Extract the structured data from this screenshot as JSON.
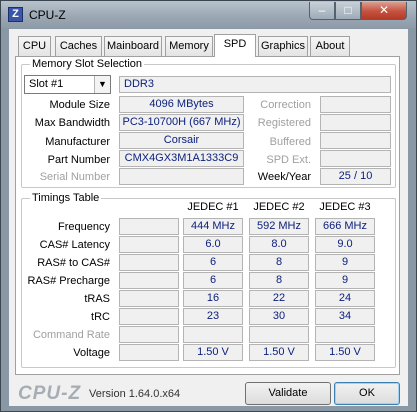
{
  "window": {
    "title": "CPU-Z",
    "app_icon": "Z",
    "min": "–",
    "max": "□",
    "close": "✕"
  },
  "tabs": [
    "CPU",
    "Caches",
    "Mainboard",
    "Memory",
    "SPD",
    "Graphics",
    "About"
  ],
  "active_tab": "SPD",
  "slot_group": {
    "title": "Memory Slot Selection",
    "slot_select": "Slot #1",
    "memory_type": "DDR3",
    "left_labels": {
      "module_size": "Module Size",
      "max_bandwidth": "Max Bandwidth",
      "manufacturer": "Manufacturer",
      "part_number": "Part Number",
      "serial_number": "Serial Number"
    },
    "left_values": {
      "module_size": "4096 MBytes",
      "max_bandwidth": "PC3-10700H (667 MHz)",
      "manufacturer": "Corsair",
      "part_number": "CMX4GX3M1A1333C9",
      "serial_number": ""
    },
    "right_labels": {
      "correction": "Correction",
      "registered": "Registered",
      "buffered": "Buffered",
      "spd_ext": "SPD Ext.",
      "week_year": "Week/Year"
    },
    "right_values": {
      "correction": "",
      "registered": "",
      "buffered": "",
      "spd_ext": "",
      "week_year": "25 / 10"
    }
  },
  "timings": {
    "title": "Timings Table",
    "columns": [
      "JEDEC #1",
      "JEDEC #2",
      "JEDEC #3"
    ],
    "rows": [
      {
        "label": "Frequency",
        "values": [
          "444 MHz",
          "592 MHz",
          "666 MHz"
        ],
        "dim": false
      },
      {
        "label": "CAS# Latency",
        "values": [
          "6.0",
          "8.0",
          "9.0"
        ],
        "dim": false
      },
      {
        "label": "RAS# to CAS#",
        "values": [
          "6",
          "8",
          "9"
        ],
        "dim": false
      },
      {
        "label": "RAS# Precharge",
        "values": [
          "6",
          "8",
          "9"
        ],
        "dim": false
      },
      {
        "label": "tRAS",
        "values": [
          "16",
          "22",
          "24"
        ],
        "dim": false
      },
      {
        "label": "tRC",
        "values": [
          "23",
          "30",
          "34"
        ],
        "dim": false
      },
      {
        "label": "Command Rate",
        "values": [
          "",
          "",
          ""
        ],
        "dim": true
      },
      {
        "label": "Voltage",
        "values": [
          "1.50 V",
          "1.50 V",
          "1.50 V"
        ],
        "dim": false
      }
    ]
  },
  "footer": {
    "logo": "CPU-Z",
    "version": "Version 1.64.0.x64",
    "validate": "Validate",
    "ok": "OK"
  }
}
